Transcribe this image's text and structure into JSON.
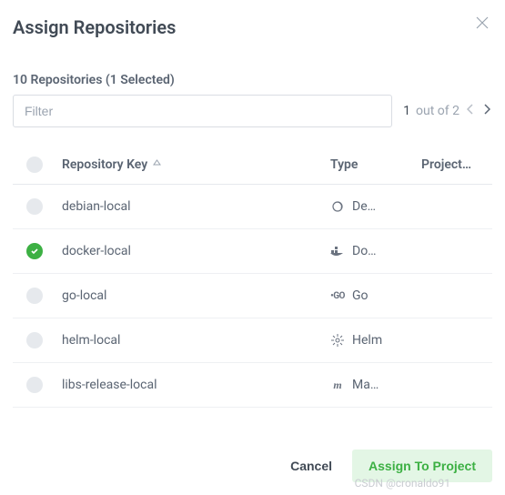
{
  "header": {
    "title": "Assign Repositories"
  },
  "subheader": "10 Repositories (1 Selected)",
  "filter": {
    "placeholder": "Filter"
  },
  "pager": {
    "current": "1",
    "label": "out of 2"
  },
  "columns": {
    "key": "Repository Key",
    "type": "Type",
    "project": "Project…"
  },
  "rows": [
    {
      "selected": false,
      "key": "debian-local",
      "type_icon": "debian",
      "type": "De…"
    },
    {
      "selected": true,
      "key": "docker-local",
      "type_icon": "docker",
      "type": "Do…"
    },
    {
      "selected": false,
      "key": "go-local",
      "type_icon": "go",
      "type": "Go"
    },
    {
      "selected": false,
      "key": "helm-local",
      "type_icon": "helm",
      "type": "Helm"
    },
    {
      "selected": false,
      "key": "libs-release-local",
      "type_icon": "maven",
      "type": "Ma…"
    }
  ],
  "buttons": {
    "cancel": "Cancel",
    "assign": "Assign To Project"
  },
  "watermark": "CSDN @cronaldo91"
}
